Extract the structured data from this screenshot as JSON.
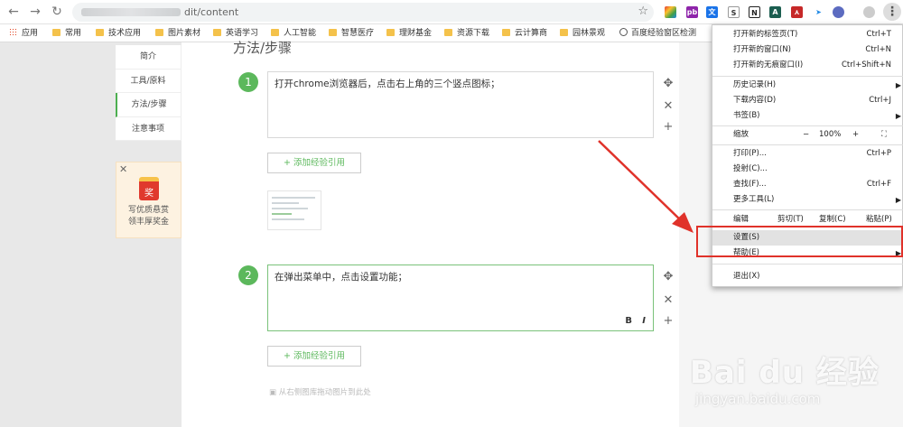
{
  "browser": {
    "url_visible": "dit/content",
    "extensions": [
      "colorful-extension",
      "pb",
      "translate",
      "S",
      "N",
      "A",
      "adobe-pdf",
      "bird",
      "circle-extension"
    ]
  },
  "bookmarks": [
    {
      "label": "应用",
      "icon": "apps-grid-icon"
    },
    {
      "label": "常用",
      "icon": "folder-icon"
    },
    {
      "label": "技术应用",
      "icon": "folder-icon"
    },
    {
      "label": "图片素材",
      "icon": "folder-icon"
    },
    {
      "label": "英语学习",
      "icon": "folder-icon"
    },
    {
      "label": "人工智能",
      "icon": "folder-icon"
    },
    {
      "label": "智慧医疗",
      "icon": "folder-icon"
    },
    {
      "label": "理财基金",
      "icon": "folder-icon"
    },
    {
      "label": "资源下载",
      "icon": "folder-icon"
    },
    {
      "label": "云计算商",
      "icon": "folder-icon"
    },
    {
      "label": "园林景观",
      "icon": "folder-icon"
    },
    {
      "label": "百度经验窗区检测",
      "icon": "globe-icon"
    }
  ],
  "sidenav": {
    "items": [
      "简介",
      "工具/原料",
      "方法/步骤",
      "注意事项"
    ]
  },
  "promo": {
    "badge": "奖",
    "line1": "写优质悬赏",
    "line2": "领丰厚奖金"
  },
  "main": {
    "heading": "方法/步骤",
    "steps": [
      {
        "number": "1",
        "text": "打开chrome浏览器后，点击右上角的三个竖点图标；"
      },
      {
        "number": "2",
        "text": "在弹出菜单中，点击设置功能；"
      }
    ],
    "ref_button": "+ 添加经验引用",
    "bold": "B",
    "italic": "I",
    "hint": "从右侧图库拖动图片到此处"
  },
  "menu": {
    "new_tab": "打开新的标签页(T)",
    "new_tab_sc": "Ctrl+T",
    "new_window": "打开新的窗口(N)",
    "new_window_sc": "Ctrl+N",
    "incognito": "打开新的无痕窗口(I)",
    "incognito_sc": "Ctrl+Shift+N",
    "history": "历史记录(H)",
    "downloads": "下载内容(D)",
    "downloads_sc": "Ctrl+J",
    "bookmarks": "书签(B)",
    "zoom": "缩放",
    "zoom_minus": "−",
    "zoom_value": "100%",
    "zoom_plus": "+",
    "print": "打印(P)...",
    "print_sc": "Ctrl+P",
    "cast": "投射(C)...",
    "find": "查找(F)...",
    "find_sc": "Ctrl+F",
    "more_tools": "更多工具(L)",
    "edit": "编辑",
    "cut": "剪切(T)",
    "copy": "复制(C)",
    "paste": "粘贴(P)",
    "settings": "设置(S)",
    "help": "帮助(E)",
    "exit": "退出(X)"
  },
  "watermark": {
    "logo": "Bai du 经验",
    "url": "jingyan.baidu.com"
  },
  "colors": {
    "accent_green": "#5cb85c",
    "highlight_red": "#e0322a",
    "folder": "#f4c24b"
  }
}
